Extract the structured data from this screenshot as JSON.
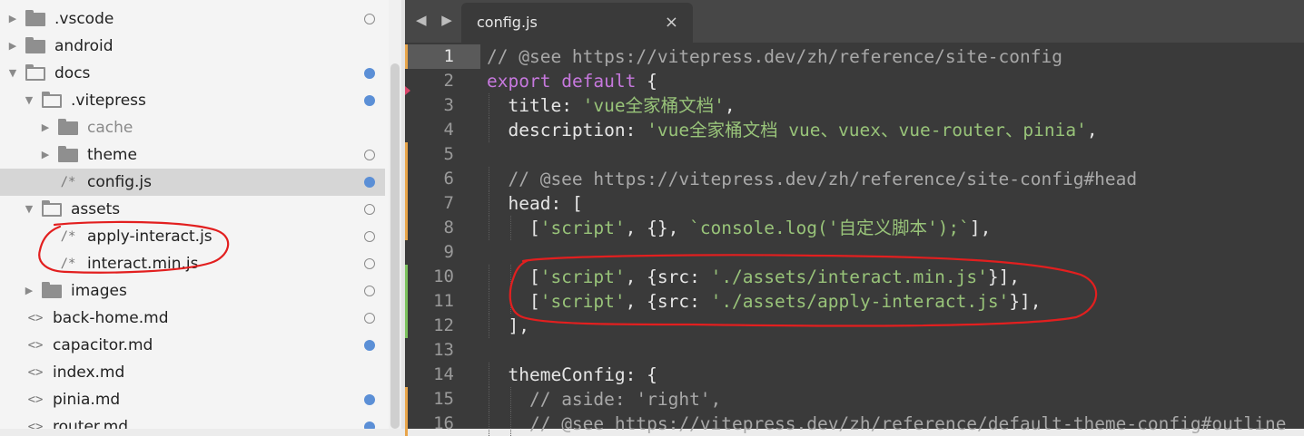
{
  "sidebar": {
    "items": [
      {
        "label": ".vscode",
        "type": "folder",
        "depth": 0,
        "expanded": false,
        "status": "hollow"
      },
      {
        "label": "android",
        "type": "folder",
        "depth": 0,
        "expanded": false,
        "status": "none"
      },
      {
        "label": "docs",
        "type": "folder",
        "depth": 0,
        "expanded": true,
        "status": "filled"
      },
      {
        "label": ".vitepress",
        "type": "folder",
        "depth": 1,
        "expanded": true,
        "status": "filled"
      },
      {
        "label": "cache",
        "type": "folder",
        "depth": 2,
        "expanded": false,
        "status": "none",
        "dim": true
      },
      {
        "label": "theme",
        "type": "folder",
        "depth": 2,
        "expanded": false,
        "status": "hollow"
      },
      {
        "label": "config.js",
        "type": "js",
        "depth": 2,
        "status": "filled",
        "selected": true
      },
      {
        "label": "assets",
        "type": "folder",
        "depth": 1,
        "expanded": true,
        "status": "hollow"
      },
      {
        "label": "apply-interact.js",
        "type": "js",
        "depth": 2,
        "status": "hollow"
      },
      {
        "label": "interact.min.js",
        "type": "js",
        "depth": 2,
        "status": "hollow"
      },
      {
        "label": "images",
        "type": "folder",
        "depth": 1,
        "expanded": false,
        "status": "hollow"
      },
      {
        "label": "back-home.md",
        "type": "md",
        "depth": 1,
        "status": "hollow"
      },
      {
        "label": "capacitor.md",
        "type": "md",
        "depth": 1,
        "status": "filled"
      },
      {
        "label": "index.md",
        "type": "md",
        "depth": 1,
        "status": "none"
      },
      {
        "label": "pinia.md",
        "type": "md",
        "depth": 1,
        "status": "filled"
      },
      {
        "label": "router.md",
        "type": "md",
        "depth": 1,
        "status": "filled"
      }
    ],
    "glyphs": {
      "js": "/*",
      "md": "<>"
    }
  },
  "tabs": {
    "nav": "◀ ▶",
    "active": {
      "label": "config.js",
      "close": "×"
    }
  },
  "editor": {
    "current_line": 1,
    "lines": [
      {
        "n": "1",
        "mark": "orange",
        "tokens": [
          [
            "c",
            "// @see https://vitepress.dev/zh/reference/site-config"
          ]
        ]
      },
      {
        "n": "2",
        "mark": "",
        "tokens": [
          [
            "k",
            "export"
          ],
          [
            "p",
            " "
          ],
          [
            "k",
            "default"
          ],
          [
            "p",
            " {"
          ]
        ]
      },
      {
        "n": "3",
        "mark": "",
        "tokens": [
          [
            "p",
            "  "
          ],
          [
            "a",
            "title"
          ],
          [
            "p",
            ": "
          ],
          [
            "s",
            "'vue全家桶文档'"
          ],
          [
            "p",
            ","
          ]
        ]
      },
      {
        "n": "4",
        "mark": "",
        "tokens": [
          [
            "p",
            "  "
          ],
          [
            "a",
            "description"
          ],
          [
            "p",
            ": "
          ],
          [
            "s",
            "'vue全家桶文档 vue、vuex、vue-router、pinia'"
          ],
          [
            "p",
            ","
          ]
        ]
      },
      {
        "n": "5",
        "mark": "orange",
        "tokens": []
      },
      {
        "n": "6",
        "mark": "orange",
        "tokens": [
          [
            "p",
            "  "
          ],
          [
            "c",
            "// @see https://vitepress.dev/zh/reference/site-config#head"
          ]
        ]
      },
      {
        "n": "7",
        "mark": "orange",
        "tokens": [
          [
            "p",
            "  "
          ],
          [
            "a",
            "head"
          ],
          [
            "p",
            ": ["
          ]
        ]
      },
      {
        "n": "8",
        "mark": "orange",
        "tokens": [
          [
            "p",
            "    ["
          ],
          [
            "s",
            "'script'"
          ],
          [
            "p",
            ", {}, "
          ],
          [
            "s",
            "`console.log('自定义脚本');`"
          ],
          [
            "p",
            "],"
          ]
        ]
      },
      {
        "n": "9",
        "mark": "",
        "tokens": []
      },
      {
        "n": "10",
        "mark": "green",
        "tokens": [
          [
            "p",
            "    ["
          ],
          [
            "s",
            "'script'"
          ],
          [
            "p",
            ", {"
          ],
          [
            "a",
            "src"
          ],
          [
            "p",
            ": "
          ],
          [
            "s",
            "'./assets/interact.min.js'"
          ],
          [
            "p",
            "}],"
          ]
        ]
      },
      {
        "n": "11",
        "mark": "green",
        "tokens": [
          [
            "p",
            "    ["
          ],
          [
            "s",
            "'script'"
          ],
          [
            "p",
            ", {"
          ],
          [
            "a",
            "src"
          ],
          [
            "p",
            ": "
          ],
          [
            "s",
            "'./assets/apply-interact.js'"
          ],
          [
            "p",
            "}],"
          ]
        ]
      },
      {
        "n": "12",
        "mark": "green",
        "tokens": [
          [
            "p",
            "  ],"
          ]
        ]
      },
      {
        "n": "13",
        "mark": "",
        "tokens": []
      },
      {
        "n": "14",
        "mark": "",
        "tokens": [
          [
            "p",
            "  "
          ],
          [
            "a",
            "themeConfig"
          ],
          [
            "p",
            ": {"
          ]
        ]
      },
      {
        "n": "15",
        "mark": "orange",
        "tokens": [
          [
            "p",
            "    "
          ],
          [
            "c",
            "// aside: 'right',"
          ]
        ]
      },
      {
        "n": "16",
        "mark": "orange",
        "tokens": [
          [
            "p",
            "    "
          ],
          [
            "c",
            "// @see https://vitepress.dev/zh/reference/default-theme-config#outline"
          ]
        ]
      }
    ]
  },
  "colors": {
    "mark_orange": "#e8a54a",
    "mark_green": "#7cc35f",
    "annotation_red": "#e21f1f",
    "status_blue": "#5b8fd6"
  }
}
